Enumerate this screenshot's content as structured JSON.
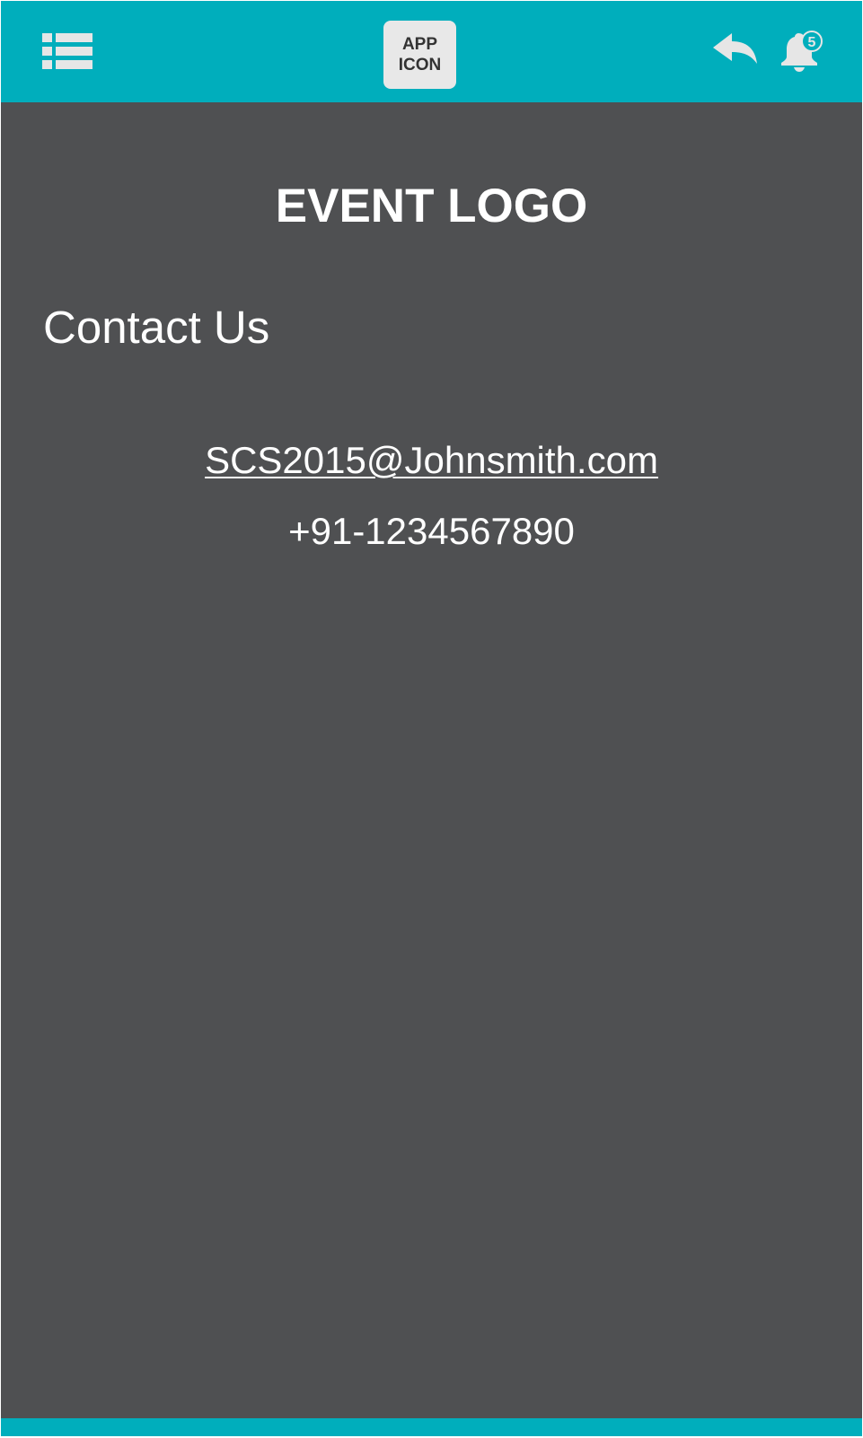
{
  "header": {
    "menu_icon": "list-menu-icon",
    "app_icon_line1": "APP",
    "app_icon_line2": "ICON",
    "back_icon": "reply-arrow-icon",
    "notification_icon": "bell-icon",
    "notification_count": "5"
  },
  "main": {
    "logo_text": "EVENT LOGO",
    "title": "Contact Us",
    "email": "SCS2015@Johnsmith.com",
    "phone": "+91-1234567890"
  },
  "colors": {
    "accent": "#00aebc",
    "background": "#4f5052",
    "text": "#ffffff",
    "app_icon_bg": "#e8e8e8",
    "icon_tint": "#e6e6e6"
  }
}
